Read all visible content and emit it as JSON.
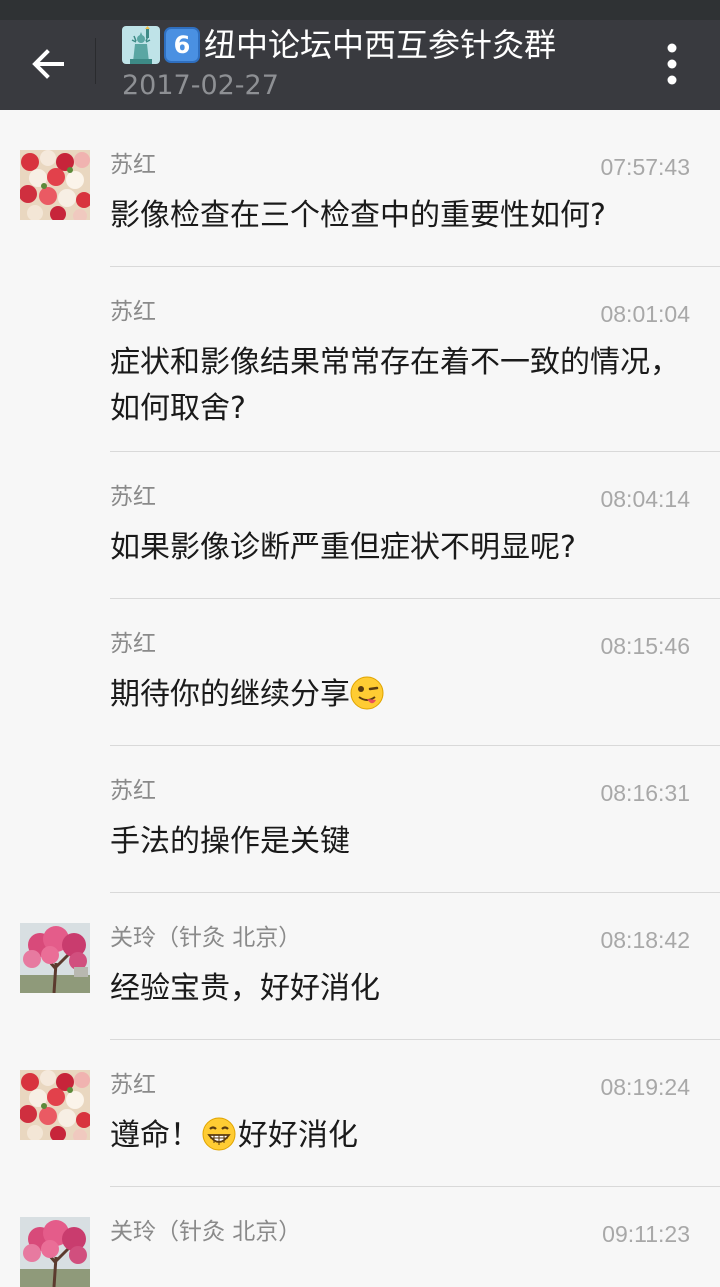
{
  "header": {
    "title": "纽中论坛中西互参针灸群",
    "keycap": "6",
    "date": "2017-02-27",
    "icons": {
      "back": "arrow-left-icon",
      "more": "more-vertical-icon",
      "liberty": "statue-of-liberty-icon",
      "keycap": "keycap-6-icon"
    }
  },
  "messages": [
    {
      "sender": "苏红",
      "time": "07:57:43",
      "text": "影像检查在三个检查中的重要性如何?",
      "avatar": "flowers"
    },
    {
      "sender": "苏红",
      "time": "08:01:04",
      "text": "症状和影像结果常常存在着不一致的情况，如何取舍?",
      "avatar": ""
    },
    {
      "sender": "苏红",
      "time": "08:04:14",
      "text": "如果影像诊断严重但症状不明显呢?",
      "avatar": ""
    },
    {
      "sender": "苏红",
      "time": "08:15:46",
      "text": "期待你的继续分享",
      "emoji_after": "winking-tongue-face-icon",
      "avatar": ""
    },
    {
      "sender": "苏红",
      "time": "08:16:31",
      "text": "手法的操作是关键",
      "avatar": ""
    },
    {
      "sender": "关玲（针灸 北京）",
      "time": "08:18:42",
      "text": "经验宝贵，好好消化",
      "avatar": "blossom-tree"
    },
    {
      "sender": "苏红",
      "time": "08:19:24",
      "text_before": "遵命！",
      "emoji_mid": "grinning-face-icon",
      "text": "好好消化",
      "avatar": "flowers"
    },
    {
      "sender": "关玲（针灸 北京）",
      "time": "09:11:23",
      "text": "",
      "avatar": "blossom-tree"
    }
  ],
  "colors": {
    "header_bg": "#393a3f",
    "page_bg": "#f7f7f7",
    "divider": "#d9d9d9"
  }
}
